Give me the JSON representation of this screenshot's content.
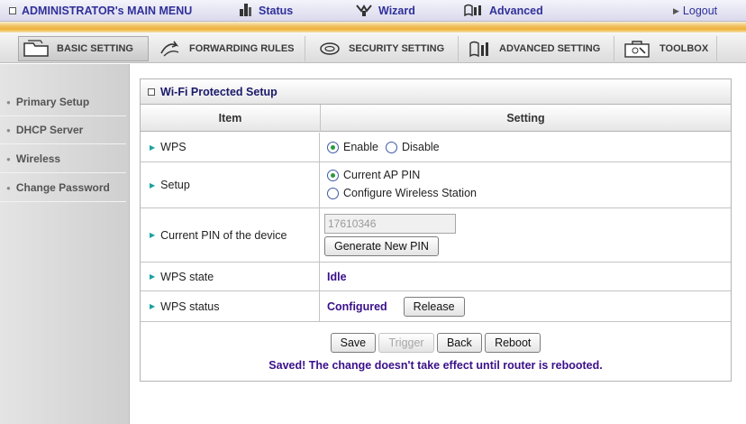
{
  "topmenu": {
    "admin_label": "ADMINISTRATOR's MAIN MENU",
    "status_label": "Status",
    "wizard_label": "Wizard",
    "advanced_label": "Advanced",
    "logout_label": "Logout"
  },
  "tabs": [
    {
      "label": "BASIC SETTING",
      "icon": "folder-icon",
      "active": true
    },
    {
      "label": "FORWARDING RULES",
      "icon": "forward-icon",
      "active": false
    },
    {
      "label": "SECURITY SETTING",
      "icon": "lock-icon",
      "active": false
    },
    {
      "label": "ADVANCED SETTING",
      "icon": "advanced-icon",
      "active": false
    },
    {
      "label": "TOOLBOX",
      "icon": "toolbox-icon",
      "active": false
    }
  ],
  "sidebar": {
    "items": [
      {
        "label": "Primary Setup"
      },
      {
        "label": "DHCP Server"
      },
      {
        "label": "Wireless"
      },
      {
        "label": "Change Password"
      }
    ]
  },
  "panel": {
    "title": "Wi-Fi Protected Setup",
    "col_item": "Item",
    "col_setting": "Setting",
    "wps": {
      "label": "WPS",
      "enable_label": "Enable",
      "disable_label": "Disable",
      "selected": "Enable"
    },
    "setup": {
      "label": "Setup",
      "option1": "Current AP PIN",
      "option2": "Configure Wireless Station",
      "selected": "Current AP PIN"
    },
    "pin": {
      "label": "Current PIN of the device",
      "value": "17610346",
      "generate_label": "Generate New PIN"
    },
    "wps_state": {
      "label": "WPS state",
      "value": "Idle"
    },
    "wps_status": {
      "label": "WPS status",
      "value": "Configured",
      "release_label": "Release"
    },
    "buttons": {
      "save": "Save",
      "trigger": "Trigger",
      "back": "Back",
      "reboot": "Reboot"
    },
    "message": "Saved! The change doesn't take effect until router is rebooted."
  },
  "colors": {
    "accent": "#30309a",
    "message": "#3a0f8a",
    "stripe": "#eeb13b"
  }
}
